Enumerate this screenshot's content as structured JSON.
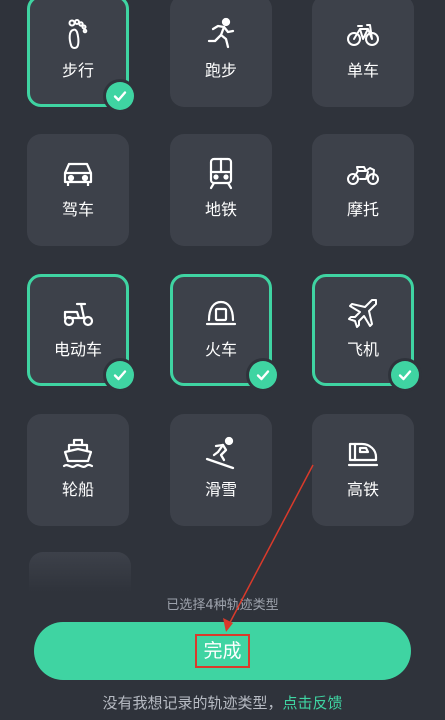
{
  "colors": {
    "background": "#2f333b",
    "tile": "#3d414a",
    "accent": "#3fd4a2",
    "annotation": "#d93a2b"
  },
  "tiles": [
    {
      "label": "步行",
      "icon": "footprint-icon",
      "selected": true
    },
    {
      "label": "跑步",
      "icon": "runner-icon",
      "selected": false
    },
    {
      "label": "单车",
      "icon": "bicycle-icon",
      "selected": false
    },
    {
      "label": "驾车",
      "icon": "car-icon",
      "selected": false
    },
    {
      "label": "地铁",
      "icon": "subway-icon",
      "selected": false
    },
    {
      "label": "摩托",
      "icon": "motorcycle-icon",
      "selected": false
    },
    {
      "label": "电动车",
      "icon": "scooter-icon",
      "selected": true
    },
    {
      "label": "火车",
      "icon": "train-icon",
      "selected": true
    },
    {
      "label": "飞机",
      "icon": "airplane-icon",
      "selected": true
    },
    {
      "label": "轮船",
      "icon": "ship-icon",
      "selected": false
    },
    {
      "label": "滑雪",
      "icon": "skiing-icon",
      "selected": false
    },
    {
      "label": "高铁",
      "icon": "high-speed-rail-icon",
      "selected": false
    }
  ],
  "hint": "已选择4种轨迹类型",
  "done_label": "完成",
  "footer": {
    "text": "没有我想记录的轨迹类型，",
    "link": "点击反馈"
  }
}
